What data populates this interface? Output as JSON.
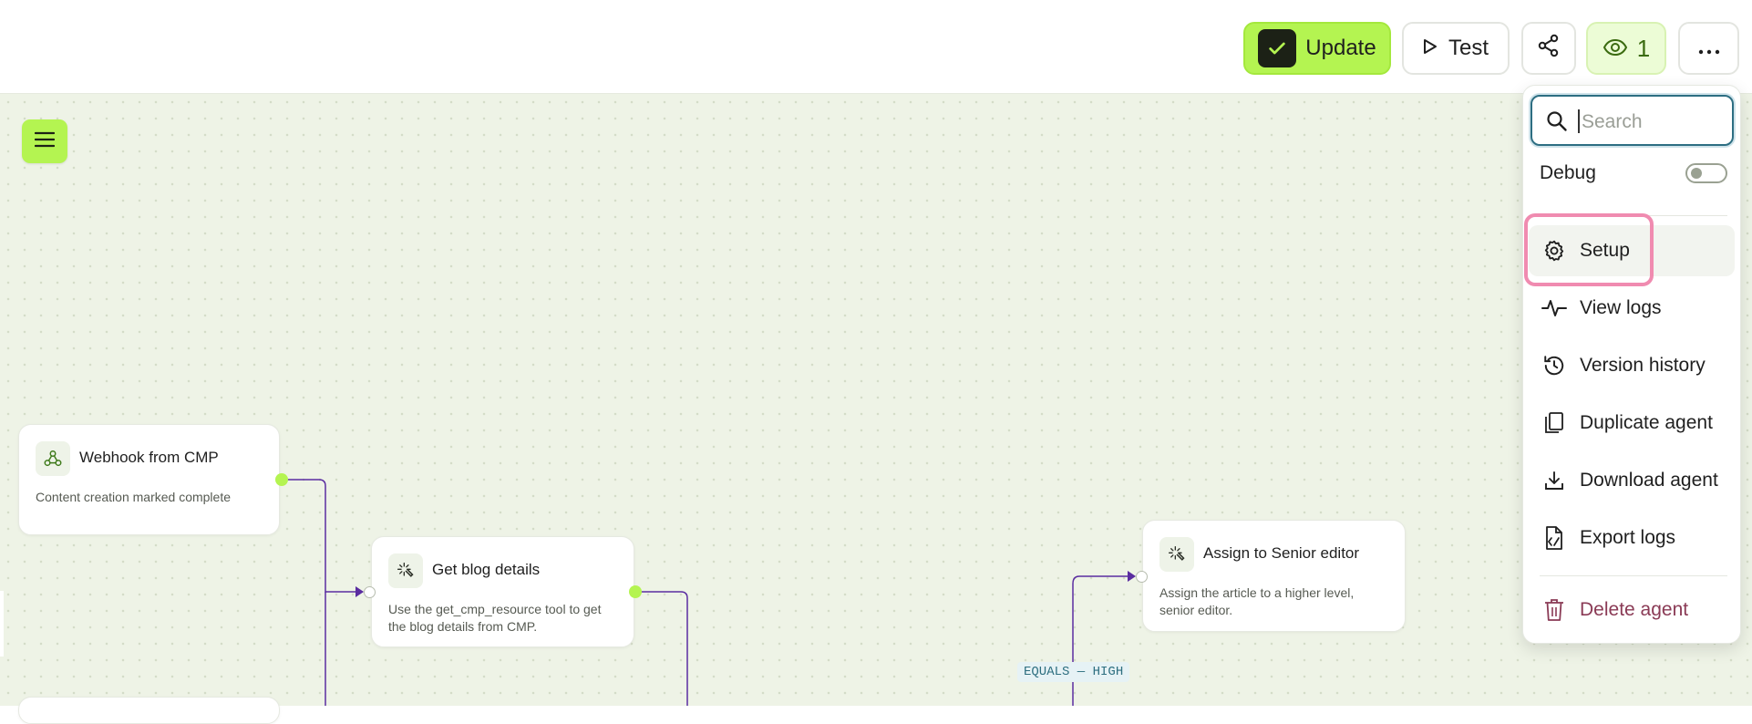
{
  "toolbar": {
    "update_label": "Update",
    "test_label": "Test",
    "viewers_count": "1"
  },
  "colors": {
    "accent_green": "#b4f451",
    "edge_purple": "#5a2ca0",
    "danger": "#8a3a55"
  },
  "menu": {
    "search_placeholder": "Search",
    "debug_label": "Debug",
    "debug_enabled": false,
    "items": [
      {
        "label": "Setup",
        "icon": "gear-icon"
      },
      {
        "label": "View logs",
        "icon": "activity-icon"
      },
      {
        "label": "Version history",
        "icon": "history-icon"
      },
      {
        "label": "Duplicate agent",
        "icon": "copy-icon"
      },
      {
        "label": "Download agent",
        "icon": "download-icon"
      },
      {
        "label": "Export logs",
        "icon": "file-export-icon"
      },
      {
        "label": "Delete agent",
        "icon": "trash-icon"
      }
    ]
  },
  "nodes": [
    {
      "title": "Webhook from CMP",
      "description": "Content creation marked complete",
      "icon": "webhook-icon"
    },
    {
      "title": "Get blog details",
      "description": "Use the get_cmp_resource tool to get the blog details from CMP.",
      "icon": "magic-wand-icon"
    },
    {
      "title": "Assign to Senior editor",
      "description": "Assign the article to a higher level, senior editor.",
      "icon": "magic-wand-icon"
    }
  ],
  "condition_label": "EQUALS — HIGH"
}
